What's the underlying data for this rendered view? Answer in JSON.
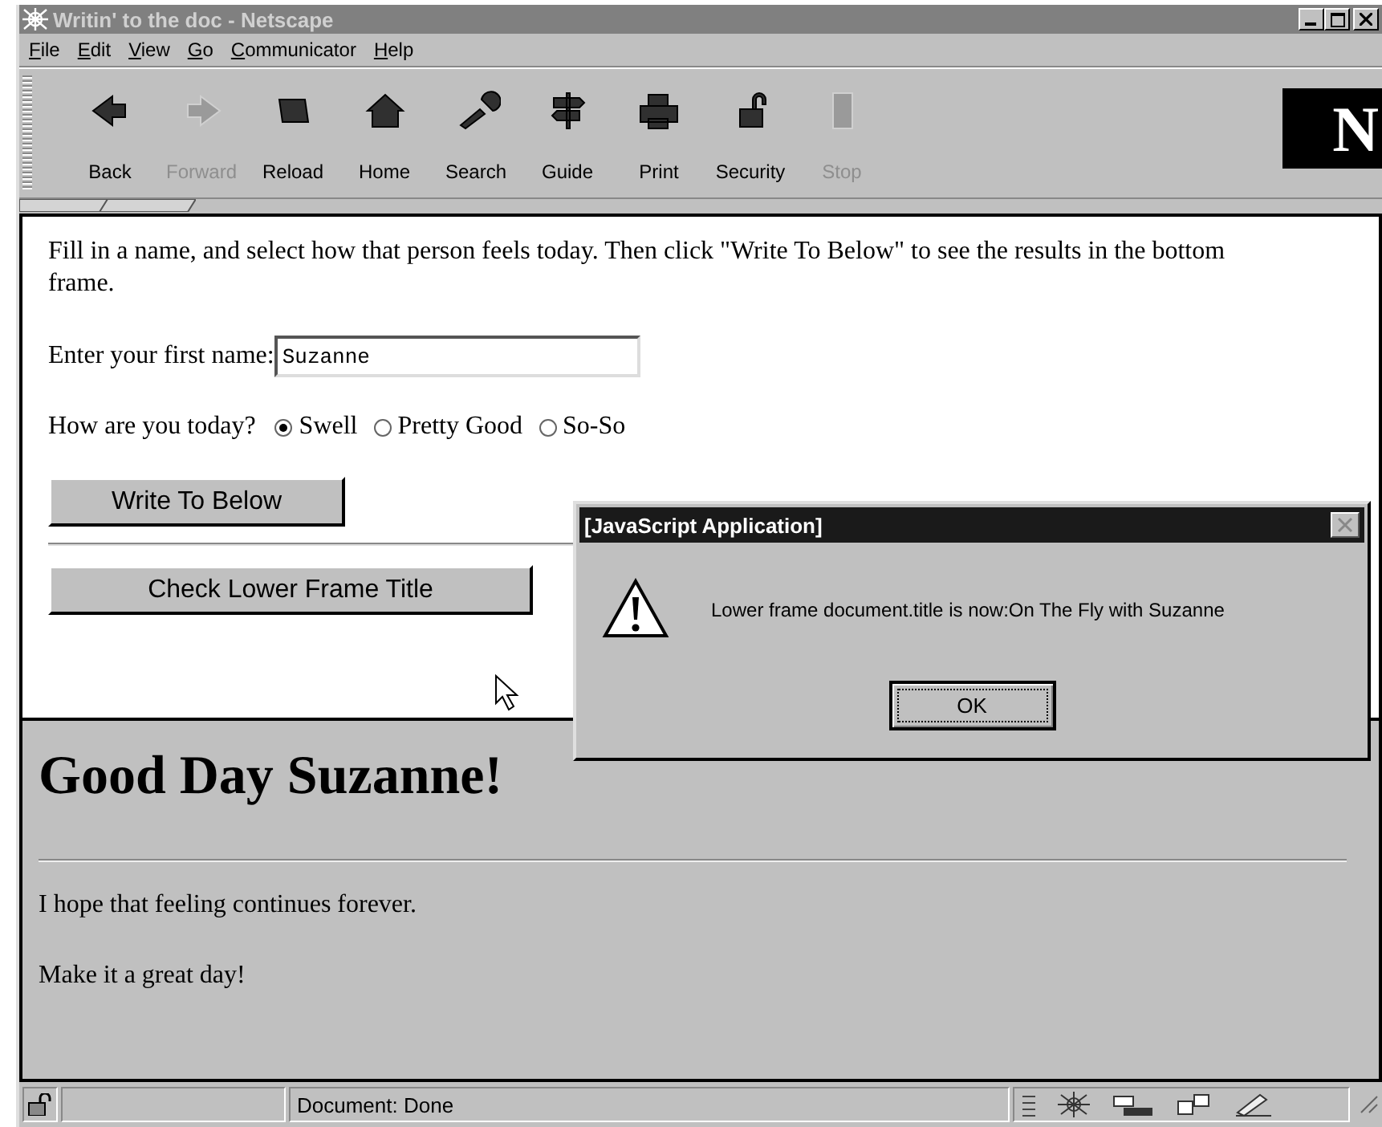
{
  "window": {
    "title": "Writin' to the doc - Netscape"
  },
  "menu": [
    "File",
    "Edit",
    "View",
    "Go",
    "Communicator",
    "Help"
  ],
  "toolbar": [
    {
      "label": "Back",
      "disabled": false
    },
    {
      "label": "Forward",
      "disabled": true
    },
    {
      "label": "Reload",
      "disabled": false
    },
    {
      "label": "Home",
      "disabled": false
    },
    {
      "label": "Search",
      "disabled": false
    },
    {
      "label": "Guide",
      "disabled": false
    },
    {
      "label": "Print",
      "disabled": false
    },
    {
      "label": "Security",
      "disabled": false
    },
    {
      "label": "Stop",
      "disabled": true
    }
  ],
  "logo": "N",
  "upper_frame": {
    "intro": "Fill in a name, and select how that person feels today. Then click \"Write To Below\" to see the results in the bottom frame.",
    "name_label": "Enter your first name:",
    "name_value": "Suzanne",
    "mood_label": "How are you today?",
    "moods": [
      {
        "label": "Swell",
        "selected": true
      },
      {
        "label": "Pretty Good",
        "selected": false
      },
      {
        "label": "So-So",
        "selected": false
      }
    ],
    "buttons": [
      "Write To Below",
      "Check Lower Frame Title"
    ]
  },
  "lower_frame": {
    "heading": "Good Day Suzanne!",
    "lines": [
      "I hope that feeling continues forever.",
      "Make it a great day!"
    ]
  },
  "dialog": {
    "title": "[JavaScript Application]",
    "message": "Lower frame document.title is now:On The Fly with Suzanne",
    "button": "OK"
  },
  "status_bar": {
    "text": "Document: Done"
  }
}
